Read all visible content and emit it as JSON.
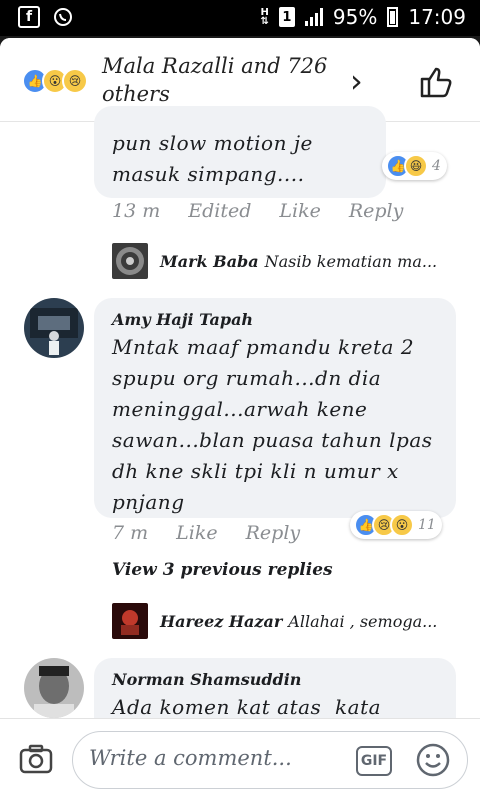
{
  "status_bar": {
    "left_icons": [
      "facebook-icon",
      "whatsapp-icon"
    ],
    "sim": "1",
    "battery": "95%",
    "time": "17:09"
  },
  "header": {
    "title": "Mala Razalli and 726 others",
    "reaction_icons": [
      "like-reaction-icon",
      "wow-reaction-icon",
      "sad-reaction-icon"
    ]
  },
  "comments": [
    {
      "text": "pun slow motion je masuk simpang....",
      "time": "13 m",
      "edited": "Edited",
      "like": "Like",
      "reply": "Reply",
      "reaction_count": "4",
      "reply_preview": {
        "name": "Mark Baba",
        "text": "Nasib kematian ma..."
      }
    },
    {
      "name": "Amy Haji Tapah",
      "text": "Mntak maaf pmandu kreta 2 spupu org rumah...dn dia meninggal...arwah kene sawan...blan puasa tahun lpas dh kne skli tpi kli n umur x pnjang",
      "time": "7 m",
      "like": "Like",
      "reply": "Reply",
      "reaction_count": "11",
      "view_previous": "View 3 previous replies",
      "reply_preview": {
        "name": "Hareez Hazar",
        "text": "Allahai , semoga..."
      }
    },
    {
      "name": "Norman Shamsuddin",
      "text": "Ada komen kat atas  kata"
    }
  ],
  "composer": {
    "placeholder": "Write a comment...",
    "gif_label": "GIF"
  },
  "colors": {
    "like_blue": "#4a8ef0",
    "emoji_yellow": "#f7c948",
    "bubble_bg": "#f0f2f5"
  }
}
